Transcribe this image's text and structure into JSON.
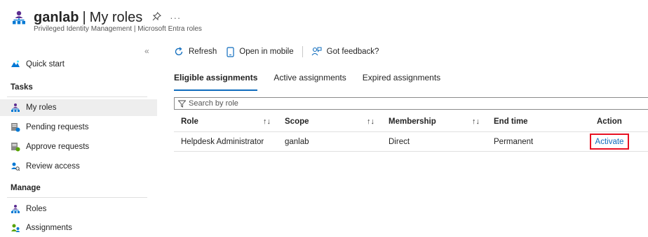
{
  "header": {
    "org": "ganlab",
    "separator": "|",
    "page_title": "My roles",
    "subtitle": "Privileged Identity Management | Microsoft Entra roles",
    "pin_icon": "pin-icon",
    "more_label": "···"
  },
  "sidebar": {
    "collapse_label": "«",
    "items_top": [
      {
        "label": "Quick start",
        "icon": "quick-start-icon"
      }
    ],
    "tasks_heading": "Tasks",
    "tasks": [
      {
        "label": "My roles",
        "icon": "my-roles-icon",
        "active": true
      },
      {
        "label": "Pending requests",
        "icon": "pending-requests-icon"
      },
      {
        "label": "Approve requests",
        "icon": "approve-requests-icon"
      },
      {
        "label": "Review access",
        "icon": "review-access-icon"
      }
    ],
    "manage_heading": "Manage",
    "manage": [
      {
        "label": "Roles",
        "icon": "roles-icon"
      },
      {
        "label": "Assignments",
        "icon": "assignments-icon"
      }
    ]
  },
  "toolbar": {
    "refresh_label": "Refresh",
    "mobile_label": "Open in mobile",
    "feedback_label": "Got feedback?"
  },
  "tabs": [
    {
      "label": "Eligible assignments",
      "active": true
    },
    {
      "label": "Active assignments"
    },
    {
      "label": "Expired assignments"
    }
  ],
  "search": {
    "placeholder": "Search by role"
  },
  "table": {
    "columns": [
      "Role",
      "Scope",
      "Membership",
      "End time",
      "Action"
    ],
    "sort_glyph": "↑↓",
    "rows": [
      {
        "role": "Helpdesk Administrator",
        "scope": "ganlab",
        "membership": "Direct",
        "end_time": "Permanent",
        "action": "Activate"
      }
    ]
  },
  "colors": {
    "accent": "#0f6cbd",
    "highlight": "#e81123"
  }
}
